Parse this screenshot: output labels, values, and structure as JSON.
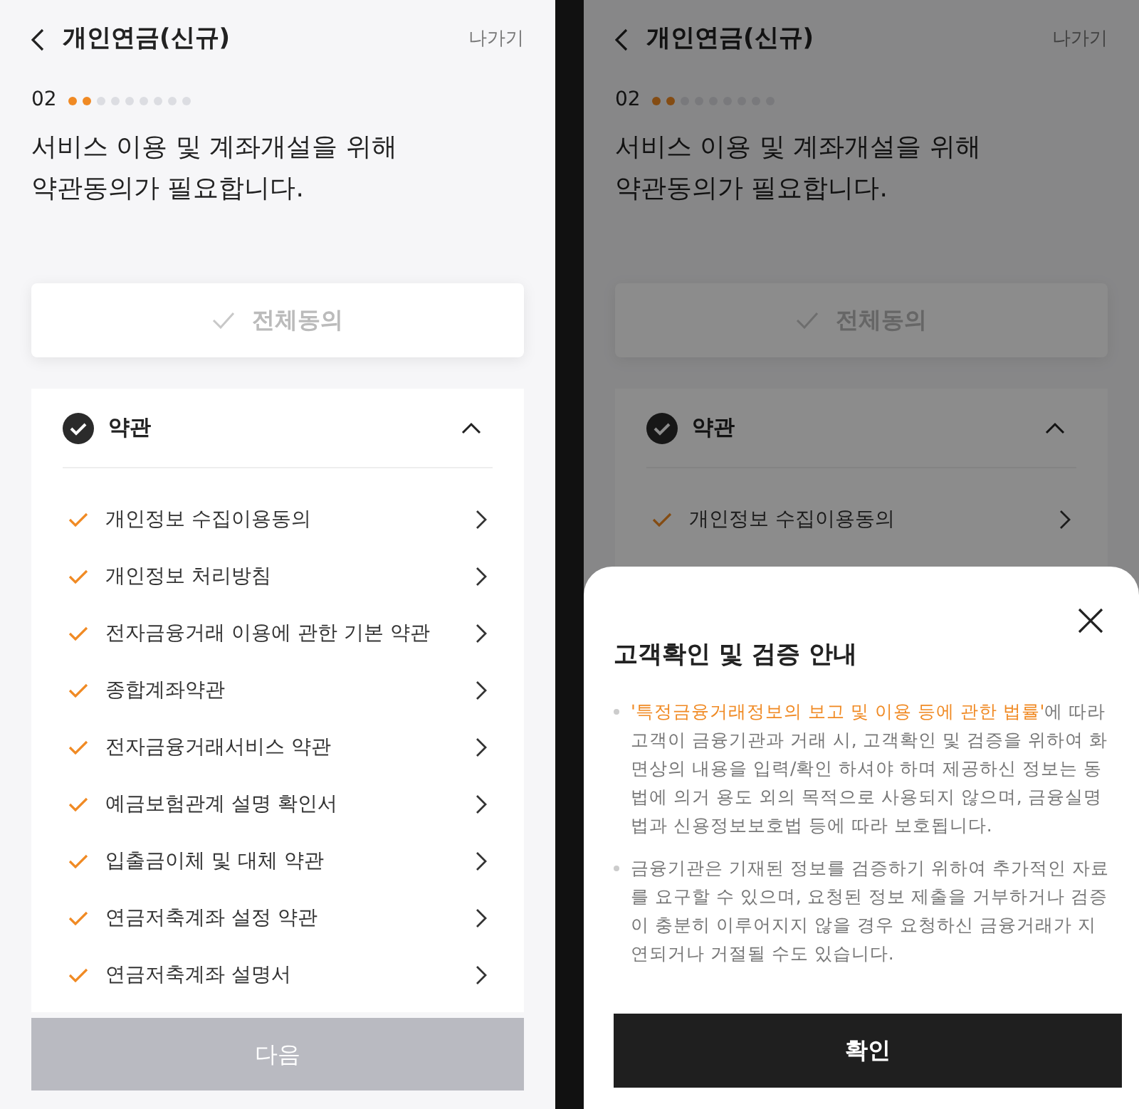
{
  "screens": [
    {
      "dimmed": false,
      "header": {
        "title": "개인연금(신규)",
        "exit": "나가기"
      },
      "step": "02",
      "steps": [
        {
          "done": true
        },
        {
          "done": true
        },
        {
          "done": false
        },
        {
          "done": false
        },
        {
          "done": false
        },
        {
          "done": false
        },
        {
          "done": false
        },
        {
          "done": false
        },
        {
          "done": false
        }
      ],
      "heading": [
        "서비스 이용 및 계좌개설을 위해",
        "약관동의가 필요합니다."
      ],
      "agree_all": {
        "label": "전체동의",
        "checked": false
      },
      "section": {
        "title": "약관",
        "checked": true,
        "expanded": true,
        "items": [
          {
            "label": "개인정보 수집이용동의",
            "checked": true
          },
          {
            "label": "개인정보 처리방침",
            "checked": true
          },
          {
            "label": "전자금융거래 이용에 관한 기본 약관",
            "checked": true
          },
          {
            "label": "종합계좌약관",
            "checked": true
          },
          {
            "label": "전자금융거래서비스 약관",
            "checked": true
          },
          {
            "label": "예금보험관계 설명 확인서",
            "checked": true
          },
          {
            "label": "입출금이체 및 대체 약관",
            "checked": true
          },
          {
            "label": "연금저축계좌 설정 약관",
            "checked": true
          },
          {
            "label": "연금저축계좌 설명서",
            "checked": true
          }
        ]
      },
      "next_button": {
        "label": "다음",
        "disabled": true
      }
    },
    {
      "dimmed": true,
      "header": {
        "title": "개인연금(신규)",
        "exit": "나가기"
      },
      "step": "02",
      "steps": [
        {
          "done": true
        },
        {
          "done": true
        },
        {
          "done": false
        },
        {
          "done": false
        },
        {
          "done": false
        },
        {
          "done": false
        },
        {
          "done": false
        },
        {
          "done": false
        },
        {
          "done": false
        }
      ],
      "heading": [
        "서비스 이용 및 계좌개설을 위해",
        "약관동의가 필요합니다."
      ],
      "agree_all": {
        "label": "전체동의",
        "checked": false
      },
      "section": {
        "title": "약관",
        "checked": true,
        "expanded": true,
        "items": [
          {
            "label": "개인정보 수집이용동의",
            "checked": true
          }
        ]
      },
      "sheet": {
        "title": "고객확인 및 검증 안내",
        "bullets": [
          {
            "highlight": "'특정금융거래정보의 보고 및 이용 등에 관한 법률'",
            "text": "에 따라 고객이 금융기관과 거래 시, 고객확인 및 검증을 위하여 화면상의 내용을 입력/확인 하셔야 하며 제공하신 정보는 동법에 의거 용도 외의 목적으로 사용되지 않으며, 금융실명법과 신용정보보호법 등에 따라 보호됩니다."
          },
          {
            "text": "금융기관은 기재된 정보를 검증하기 위하여 추가적인 자료를 요구할 수 있으며, 요청된 정보 제출을 거부하거나 검증이 충분히 이루어지지 않을 경우 요청하신 금융거래가 지연되거나 거절될 수도 있습니다."
          }
        ],
        "confirm": "확인"
      }
    }
  ]
}
